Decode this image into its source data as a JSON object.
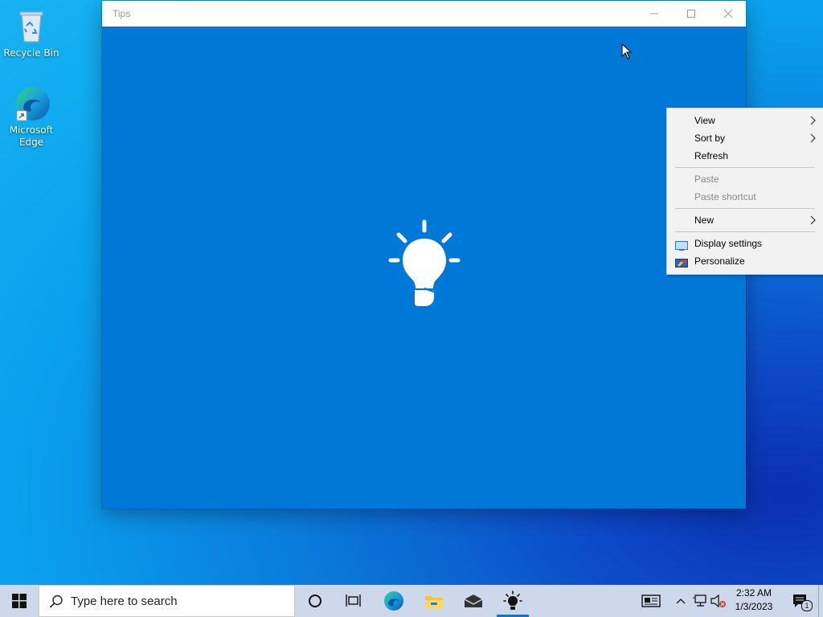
{
  "desktop": {
    "icons": [
      {
        "label": "Recycle Bin"
      },
      {
        "label_line1": "Microsoft",
        "label_line2": "Edge"
      }
    ]
  },
  "window": {
    "title": "Tips",
    "controls": {
      "minimize": "–",
      "maximize": "☐",
      "close": "✕"
    }
  },
  "context_menu": {
    "items": [
      {
        "label": "View",
        "has_submenu": true,
        "enabled": true
      },
      {
        "label": "Sort by",
        "has_submenu": true,
        "enabled": true
      },
      {
        "label": "Refresh",
        "enabled": true
      },
      {
        "label": "Paste",
        "enabled": false
      },
      {
        "label": "Paste shortcut",
        "enabled": false
      },
      {
        "label": "New",
        "has_submenu": true,
        "enabled": true
      },
      {
        "label": "Display settings",
        "icon": "display-icon",
        "enabled": true
      },
      {
        "label": "Personalize",
        "icon": "personalize-icon",
        "enabled": true
      }
    ],
    "submenu_arrow": "›"
  },
  "taskbar": {
    "search_placeholder": "Type here to search",
    "pinned": [
      "cortana-icon",
      "task-view-icon",
      "edge-icon",
      "file-explorer-icon",
      "mail-icon",
      "tips-icon"
    ],
    "tray": {
      "time": "2:32 AM",
      "date": "1/3/2023",
      "notification_count": "1"
    }
  },
  "colors": {
    "window_bg": "#0078d7",
    "accent": "#0078d7",
    "menu_bg": "#f2f2f2"
  }
}
